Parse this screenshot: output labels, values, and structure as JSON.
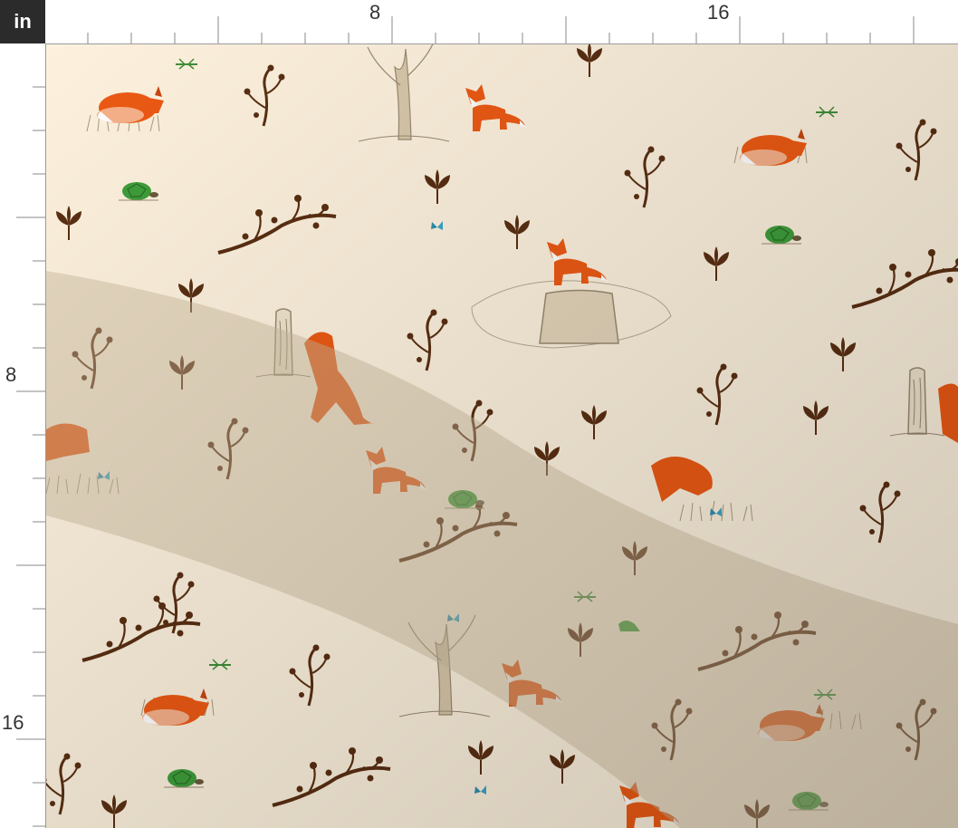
{
  "ruler": {
    "unit": "in",
    "top_labels": [
      "8",
      "16"
    ],
    "left_labels": [
      "8",
      "16"
    ]
  },
  "fabric": {
    "background": "#fdf1dd",
    "shadow": "#d9c9b0",
    "branch_color": "#5a2f12",
    "fox_color": "#ec5a14",
    "turtle_color": "#3f9e3a",
    "butterfly_color": "#2f8fb0",
    "sketch_color": "#9a8a72"
  }
}
